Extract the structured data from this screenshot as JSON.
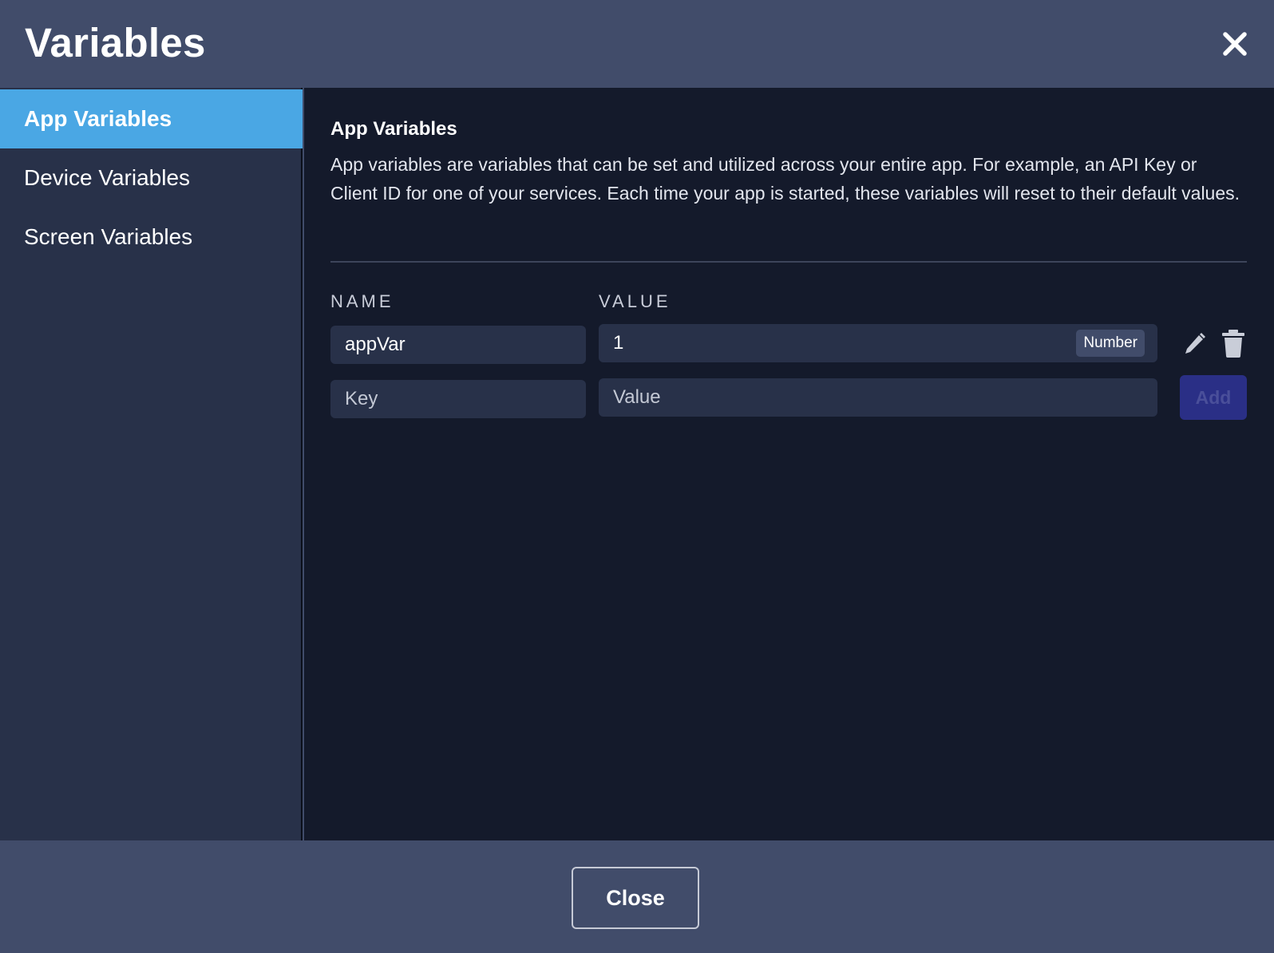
{
  "dialog": {
    "title": "Variables",
    "close_icon": "close-icon"
  },
  "sidebar": {
    "items": [
      {
        "label": "App Variables",
        "active": true
      },
      {
        "label": "Device Variables",
        "active": false
      },
      {
        "label": "Screen Variables",
        "active": false
      }
    ]
  },
  "main": {
    "section_title": "App Variables",
    "description": "App variables are variables that can be set and utilized across your entire app. For example, an API Key or Client ID for one of your services. Each time your app is started, these variables will reset to their default values.",
    "columns": {
      "name": "NAME",
      "value": "VALUE"
    },
    "rows": [
      {
        "name": "appVar",
        "value": "1",
        "type": "Number"
      }
    ],
    "new_row": {
      "key_placeholder": "Key",
      "value_placeholder": "Value",
      "add_label": "Add"
    },
    "row_icons": [
      "pencil-icon",
      "trash-icon"
    ]
  },
  "footer": {
    "close_label": "Close"
  },
  "colors": {
    "header_bg": "#414c6a",
    "sidebar_bg": "#283149",
    "sidebar_active": "#4aa7e4",
    "main_bg": "#141a2b",
    "field_bg": "#283149",
    "add_button": "#2a2f86"
  }
}
